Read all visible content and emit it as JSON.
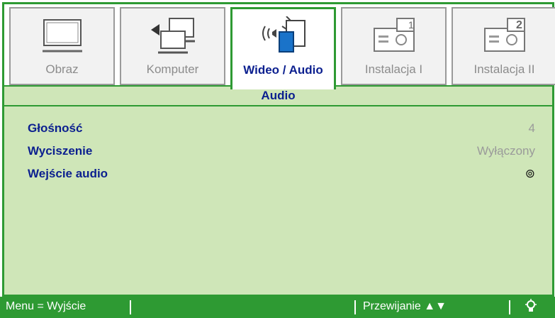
{
  "tabs": [
    {
      "label": "Obraz",
      "icon": "monitor-icon",
      "active": false
    },
    {
      "label": "Komputer",
      "icon": "computer-icon",
      "active": false
    },
    {
      "label": "Wideo / Audio",
      "icon": "video-audio-icon",
      "active": true
    },
    {
      "label": "Instalacja I",
      "icon": "projector-1-icon",
      "active": false
    },
    {
      "label": "Instalacja II",
      "icon": "projector-2-icon",
      "active": false
    }
  ],
  "section_title": "Audio",
  "settings": [
    {
      "name": "Głośność",
      "value": "4"
    },
    {
      "name": "Wyciszenie",
      "value": "Wyłączony"
    },
    {
      "name": "Wejście audio",
      "value": "⊚"
    }
  ],
  "statusbar": {
    "menu_hint": "Menu = Wyjście",
    "scroll_hint": "Przewijanie ▲▼",
    "bulb_icon": "lamp-icon"
  },
  "colors": {
    "accent": "#2e9a33",
    "panel": "#cfe6b8",
    "label": "#0b1f8f",
    "inactive": "#9a9a9a"
  }
}
